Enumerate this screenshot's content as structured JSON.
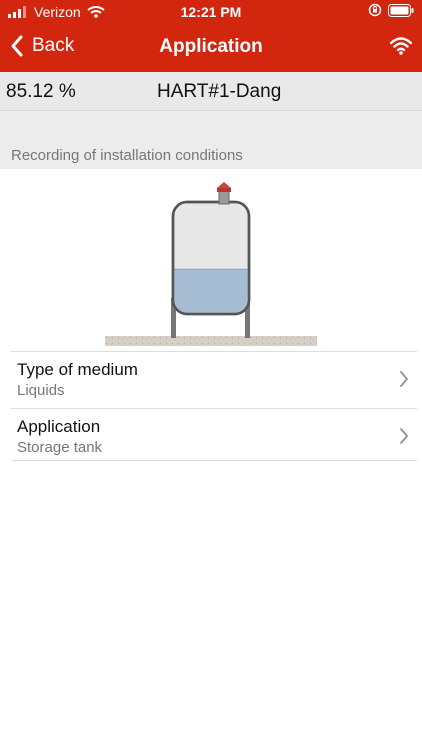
{
  "status_bar": {
    "carrier": "Verizon",
    "time": "12:21 PM"
  },
  "nav": {
    "back_label": "Back",
    "title": "Application",
    "back_icon": "chevron-left-icon",
    "right_icon": "wifi-icon"
  },
  "value_bar": {
    "value": "85.12 %",
    "device": "HART#1-Dang"
  },
  "section": {
    "header": "Recording of installation conditions"
  },
  "illustration": {
    "type": "storage-tank",
    "fill_level_fraction": 0.4
  },
  "list": [
    {
      "title": "Type of medium",
      "value": "Liquids"
    },
    {
      "title": "Application",
      "value": "Storage tank"
    }
  ],
  "colors": {
    "accent": "#d3260f",
    "value_bar_bg": "#e9e9e9",
    "section_bg": "#ececec",
    "liquid": "#a6bcd3"
  }
}
